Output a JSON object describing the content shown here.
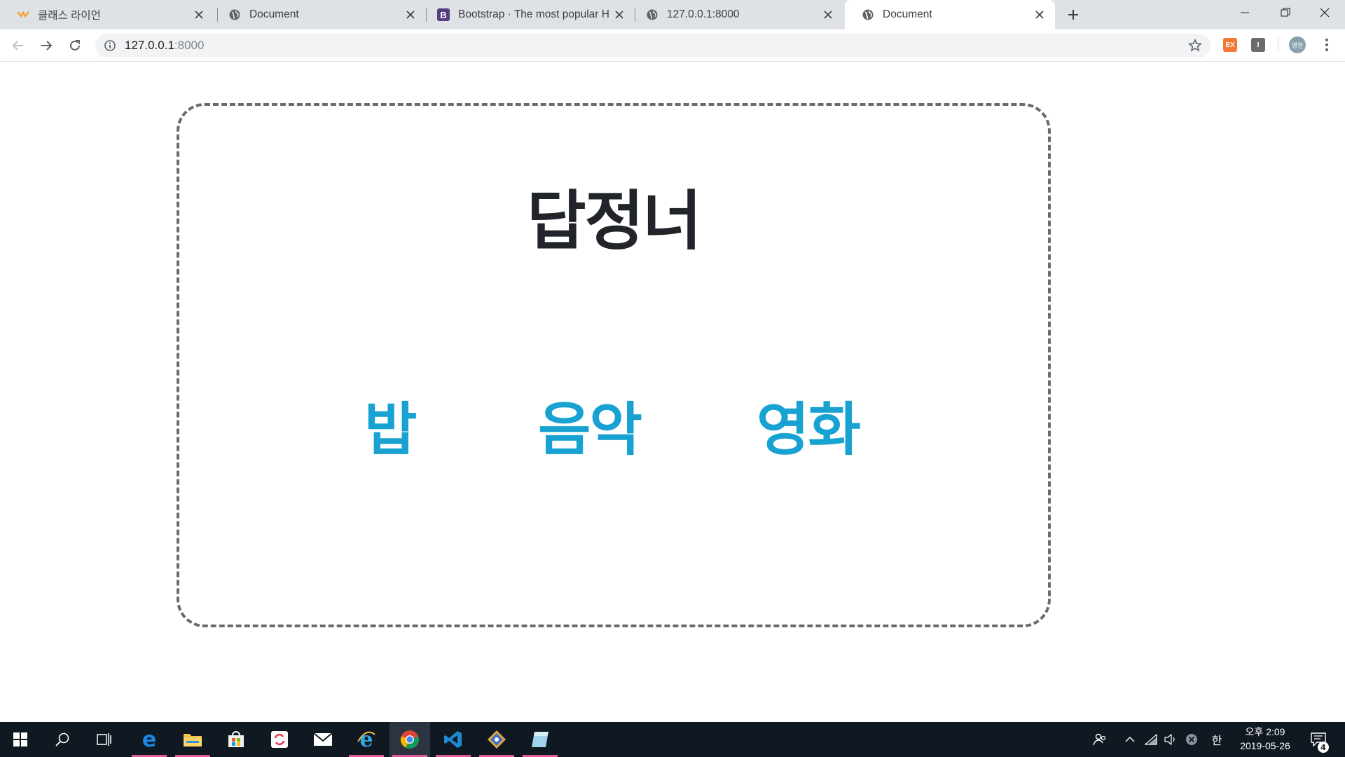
{
  "browser": {
    "tabs": [
      {
        "title": "클래스 라이언",
        "icon": "class-lion-favicon",
        "active": false
      },
      {
        "title": "Document",
        "icon": "globe-icon",
        "active": false
      },
      {
        "title": "Bootstrap · The most popular H",
        "icon": "bootstrap-icon",
        "active": false
      },
      {
        "title": "127.0.0.1:8000",
        "icon": "globe-icon",
        "active": false
      },
      {
        "title": "Document",
        "icon": "globe-icon",
        "active": true
      }
    ],
    "address": {
      "host": "127.0.0.1",
      "port": ":8000"
    },
    "extensions": [
      {
        "label": "EX",
        "color": "#f37735"
      },
      {
        "label": "I",
        "color": "#6b6b6b"
      }
    ],
    "profile_label": "영현"
  },
  "page": {
    "heading": "답정너",
    "links": [
      "밥",
      "음악",
      "영화"
    ],
    "heading_color": "#212529",
    "link_color": "#17a2d2",
    "border_color": "#6b6b6b"
  },
  "taskbar": {
    "apps": [
      "start-icon",
      "search-icon",
      "task-view-icon",
      "edge-icon",
      "file-explorer-icon",
      "store-icon",
      "sync-app-icon",
      "mail-icon",
      "internet-explorer-icon",
      "chrome-icon",
      "vscode-icon",
      "git-icon",
      "notes-icon"
    ],
    "ime": "한",
    "clock": {
      "ampm_time": "오후 2:09",
      "date": "2019-05-26"
    },
    "notifications": "4"
  }
}
